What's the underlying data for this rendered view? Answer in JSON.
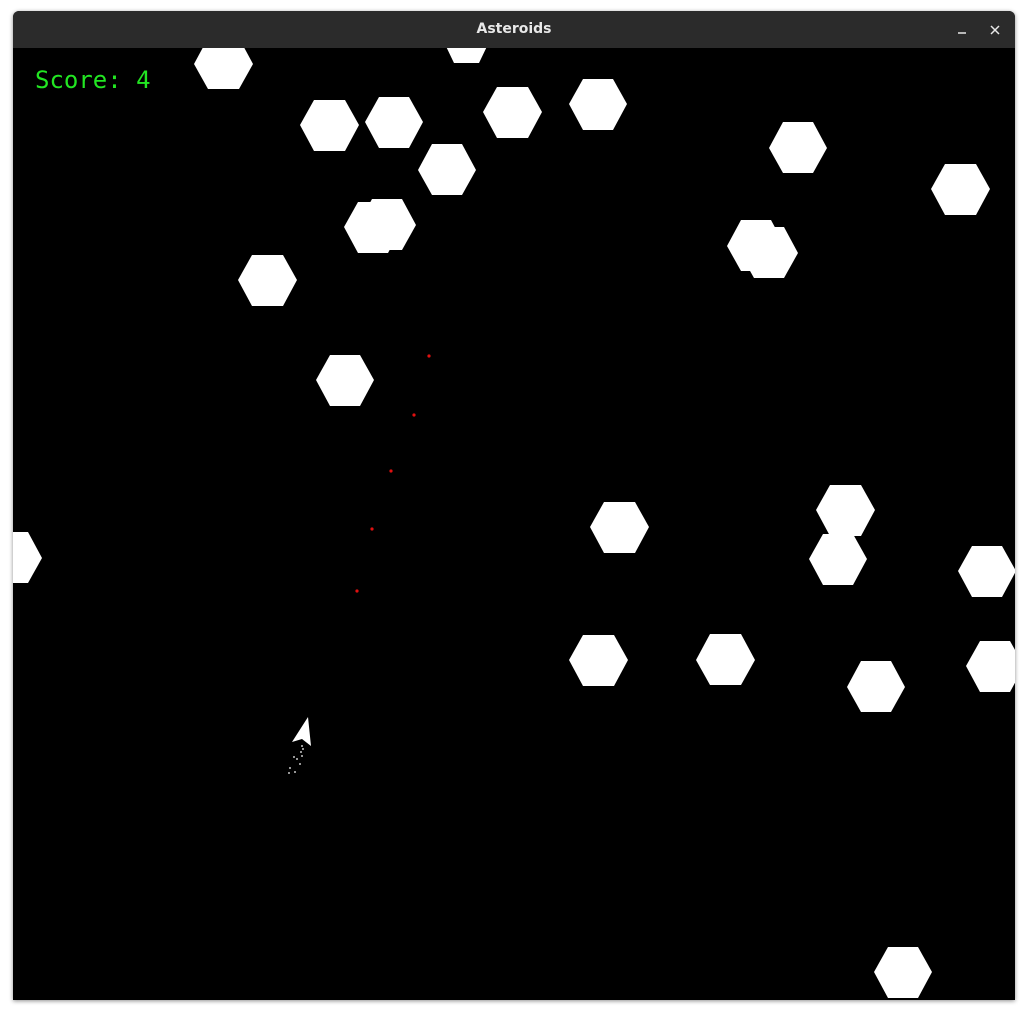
{
  "window": {
    "title": "Asteroids"
  },
  "hud": {
    "score_text": "Score: 4"
  },
  "colors": {
    "background": "#000000",
    "asteroid": "#ffffff",
    "score": "#22e622",
    "bullet": "#e01010",
    "ship": "#ffffff",
    "titlebar": "#2b2b2b"
  },
  "icons": {
    "minimize": "minimize-icon",
    "close": "close-icon"
  }
}
